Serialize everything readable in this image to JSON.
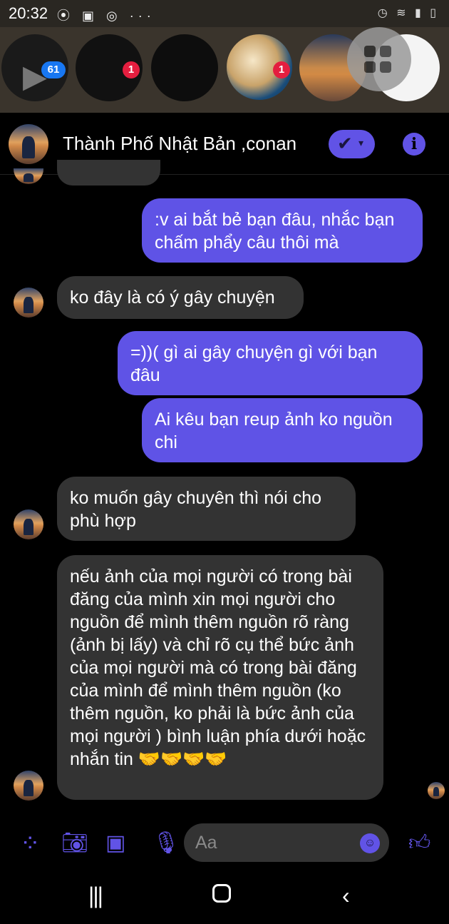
{
  "status_bar": {
    "time": "20:32",
    "left_icons": "⦿ ▣ ◎ ···",
    "right_icons": "◷ ≋ ▮ ▯"
  },
  "chat_heads": [
    {
      "badge": "61"
    },
    {
      "badge": "1"
    },
    {
      "badge": null
    },
    {
      "badge": "1"
    },
    {
      "badge": null
    },
    {
      "badge": null
    }
  ],
  "header": {
    "contact_name": "Thành Phố Nhật Bản ,conan",
    "info_glyph": "i"
  },
  "messages": [
    {
      "dir": "out",
      "text": ":v ai bắt bẻ bạn đâu, nhắc bạn chấm phẩy câu  thôi mà"
    },
    {
      "dir": "in",
      "text": "ko đây là có ý gây chuyện"
    },
    {
      "dir": "out",
      "text": "=))( gì ai gây chuyện gì với bạn đâu"
    },
    {
      "dir": "out",
      "text": "Ai kêu bạn reup ảnh ko nguồn chi"
    },
    {
      "dir": "in",
      "text": "ko muốn gây chuyên thì nói cho phù hợp"
    },
    {
      "dir": "in",
      "text": "nếu ảnh của mọi người có trong bài đăng của mình xin mọi người cho nguồn để mình thêm nguồn rõ ràng (ảnh bị lấy) và chỉ rõ cụ thể bức ảnh của mọi người mà có trong bài đăng của mình để mình thêm nguồn (ko thêm nguồn, ko phải là bức ảnh của mọi người ) bình luận phía dưới hoặc nhắn tin 🤝🤝🤝🤝"
    }
  ],
  "composer": {
    "placeholder": "Aa",
    "icons": [
      "apps-icon",
      "camera-icon",
      "gallery-icon",
      "mic-icon",
      "emoji-icon",
      "thumbs-up-icon"
    ]
  },
  "colors": {
    "accent": "#5f53e6",
    "incoming_bubble": "#333333",
    "background": "#000000"
  }
}
